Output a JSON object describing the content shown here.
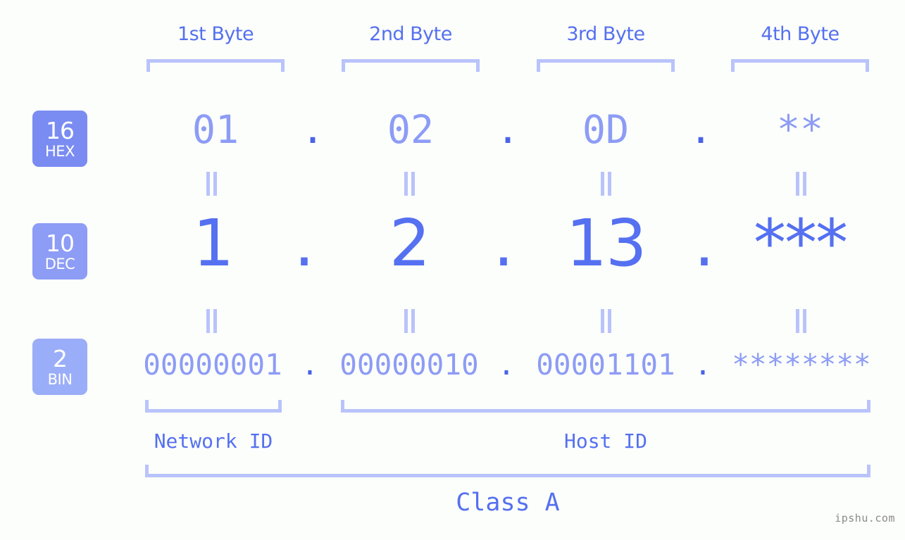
{
  "background_color": "#fcfefb",
  "accent": {
    "strong": "#4a63e8",
    "mid": "#5570f0",
    "soft": "#8d9cf5",
    "pale": "#b9c3fb"
  },
  "byte_headers": [
    {
      "label": "1st Byte"
    },
    {
      "label": "2nd Byte"
    },
    {
      "label": "3rd Byte"
    },
    {
      "label": "4th Byte"
    }
  ],
  "bases": [
    {
      "number": "16",
      "name": "HEX",
      "color": "#7a8cf2"
    },
    {
      "number": "10",
      "name": "DEC",
      "color": "#8d9cf5"
    },
    {
      "number": "2",
      "name": "BIN",
      "color": "#9aadf8"
    }
  ],
  "rows": {
    "hex": {
      "base_number": "16",
      "base_name": "HEX",
      "values": [
        "01",
        "02",
        "0D",
        "**"
      ],
      "separator": "."
    },
    "dec": {
      "base_number": "10",
      "base_name": "DEC",
      "values": [
        "1",
        "2",
        "13",
        "***"
      ],
      "separator": "."
    },
    "bin": {
      "base_number": "2",
      "base_name": "BIN",
      "values": [
        "00000001",
        "00000010",
        "00001101",
        "********"
      ],
      "separator": "."
    }
  },
  "equals_symbol": "=",
  "id_sections": [
    {
      "label": "Network ID"
    },
    {
      "label": "Host ID"
    }
  ],
  "class_label": "Class A",
  "watermark": "ipshu.com"
}
